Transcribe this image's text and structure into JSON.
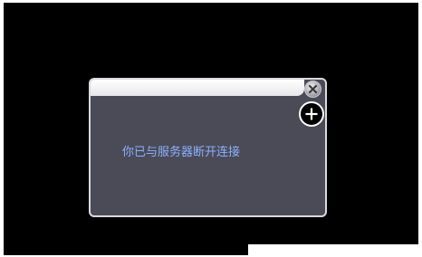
{
  "dialog": {
    "message": "你已与服务器断开连接",
    "close_icon": "close-icon",
    "add_icon": "plus-circle-icon"
  },
  "colors": {
    "screen_background": "#000000",
    "dialog_background": "#4b4b57",
    "dialog_border": "#d9d9de",
    "message_text": "#8ab0ff"
  }
}
